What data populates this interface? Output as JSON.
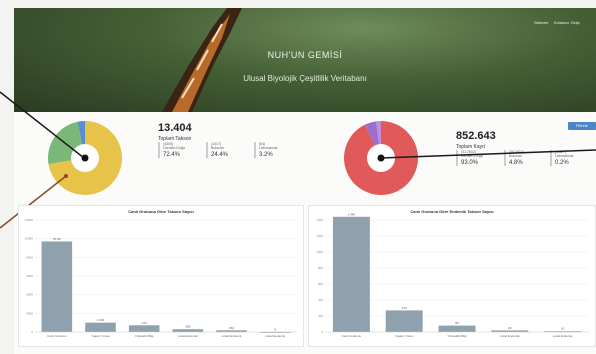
{
  "hero": {
    "title": "NUH'UN GEMİSİ",
    "subtitle": "Ulusal Biyolojik Çeşitlilik Veritabanı",
    "nav": [
      "Sisteme",
      "Kullanıcı Girişi"
    ]
  },
  "summary_left": {
    "value": "13.404",
    "label": "Toplam Takson",
    "breakdown": [
      {
        "mini": [
          "(4305)",
          "Görülen Doğa"
        ],
        "pct": "72.4%",
        "color": "#e8c34a"
      },
      {
        "mini": [
          "(1417)",
          "Bulunan"
        ],
        "pct": "24.4%",
        "color": "#7ab87a"
      },
      {
        "mini": [
          "(64)",
          "Laboratuvar"
        ],
        "pct": "3.2%",
        "color": "#5b8bd0"
      }
    ]
  },
  "summary_right": {
    "value": "852.643",
    "label": "Toplam Kayıt",
    "breakdown": [
      {
        "mini": [
          "(41.2502)",
          "Görülen Doğa"
        ],
        "pct": "93.0%",
        "color": "#e15a5a"
      },
      {
        "mini": [
          "(38.3002)",
          "Bulunan"
        ],
        "pct": "4.8%",
        "color": "#9b6fd0"
      },
      {
        "mini": [
          "(1.627)",
          "Laboratuvar"
        ],
        "pct": "0.2%",
        "color": "#5b8bd0"
      }
    ]
  },
  "toolbar": {
    "button_label": "Filtrele"
  },
  "colors": {
    "bar": "#8fa1ad",
    "donut_left_bg": "#e8c34a",
    "donut_right_bg": "#e15a5a"
  },
  "chart_data": [
    {
      "type": "pie",
      "name": "Toplam Takson dağılımı",
      "values": [
        72.4,
        24.4,
        3.2
      ],
      "colors": [
        "#e8c34a",
        "#7ab87a",
        "#5b8bd0"
      ]
    },
    {
      "type": "pie",
      "name": "Toplam Kayıt dağılımı",
      "values": [
        93.0,
        4.8,
        0.2,
        2.0
      ],
      "colors": [
        "#e15a5a",
        "#9b6fd0",
        "#5b8bd0",
        "#c58ad8"
      ]
    },
    {
      "type": "bar",
      "title": "Canlı Grubuna Göre Takson Sayısı",
      "categories": [
        "Canlı Grubunu",
        "Yaşam Yöresi",
        "Yükseklik Bilgi",
        "Lokal Endemik",
        "Lokal Endemik",
        "Lokal Endemik"
      ],
      "values": [
        9700,
        1000,
        720,
        300,
        180,
        5
      ],
      "data_labels": [
        "97.00",
        "1.000",
        "720",
        "300",
        "180",
        "5"
      ],
      "ylim": [
        0,
        12000
      ],
      "yticks": [
        "0",
        "2000",
        "4000",
        "6000",
        "8000",
        "10000",
        "12000"
      ]
    },
    {
      "type": "bar",
      "title": "Canlı Grubuna Göre Endemik Takson Sayısı",
      "categories": [
        "Canlı Grubunu",
        "Yaşam Yöresi",
        "Yükseklik Bilgi",
        "Lokal Endemik",
        "Lokal Endemik"
      ],
      "values": [
        1440,
        270,
        80,
        20,
        10
      ],
      "data_labels": [
        "1.440",
        "270",
        "80",
        "20",
        "10"
      ],
      "ylim": [
        0,
        1400
      ],
      "yticks": [
        "0",
        "200",
        "400",
        "600",
        "800",
        "1000",
        "1200",
        "1400"
      ]
    }
  ]
}
